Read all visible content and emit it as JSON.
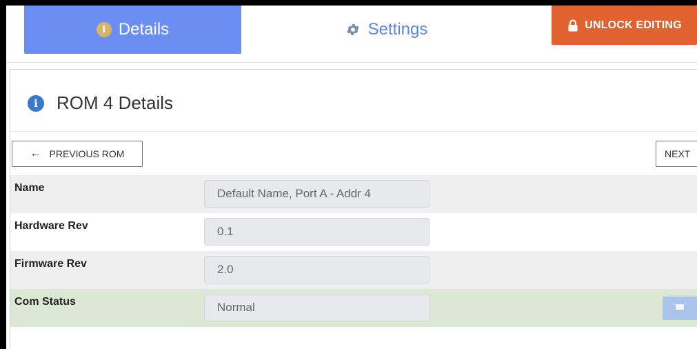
{
  "tabs": {
    "details_label": "Details",
    "settings_label": "Settings"
  },
  "unlock_button": {
    "label": "UNLOCK EDITING"
  },
  "panel": {
    "title": "ROM 4 Details"
  },
  "navigation": {
    "previous_label": "PREVIOUS ROM",
    "next_label": "NEXT"
  },
  "rows": [
    {
      "label": "Name",
      "value": "Default Name, Port A - Addr 4"
    },
    {
      "label": "Hardware Rev",
      "value": "0.1"
    },
    {
      "label": "Firmware Rev",
      "value": "2.0"
    },
    {
      "label": "Com Status",
      "value": "Normal"
    }
  ],
  "colors": {
    "tab_active": "#6b8ef2",
    "unlock": "#e0622f",
    "status_ok": "#dbe8d3"
  },
  "icons": {
    "details": "info-icon",
    "settings": "gear-icon",
    "unlock": "lock-icon",
    "title": "info-icon",
    "previous": "arrow-left-icon",
    "status": "status-icon"
  }
}
